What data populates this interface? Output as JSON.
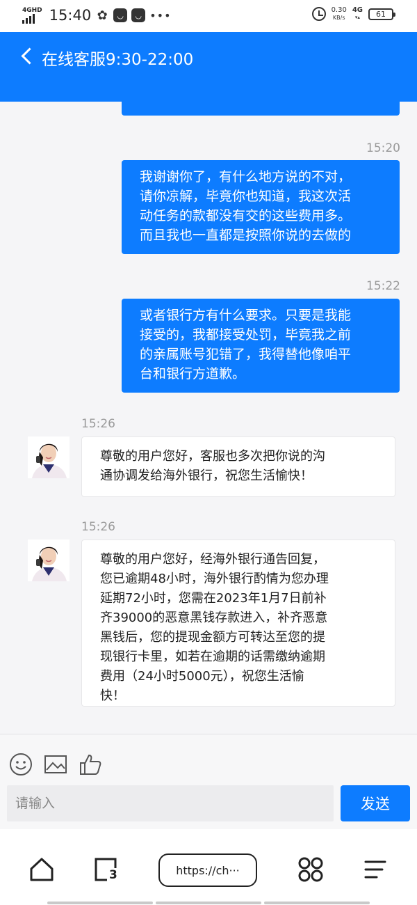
{
  "status_bar": {
    "network_type": "4GHD",
    "time": "15:40",
    "speed_value": "0.30",
    "speed_unit": "KB/s",
    "cellular": "4G",
    "battery": "61"
  },
  "header": {
    "title": "在线客服9:30-22:00"
  },
  "messages": [
    {
      "side": "right",
      "time": "15:20",
      "lines": [
        "我谢谢你了，有什么地方说的不对，",
        "请你凉解，毕竟你也知道，我这次活",
        "动任务的款都没有交的这些费用多。",
        "而且我也一直都是按照你说的去做的"
      ]
    },
    {
      "side": "right",
      "time": "15:22",
      "lines": [
        "或者银行方有什么要求。只要是我能",
        "接受的，我都接受处罚，毕竟我之前",
        "的亲属账号犯错了，我得替他像咱平",
        "台和银行方道歉。"
      ]
    },
    {
      "side": "left",
      "time": "15:26",
      "lines": [
        "尊敬的用户您好，客服也多次把你说的沟",
        "通协调发给海外银行，祝您生活愉快！"
      ]
    },
    {
      "side": "left",
      "time": "15:26",
      "lines": [
        "尊敬的用户您好，经海外银行通告回复，",
        "您已逾期48小时，海外银行酌情为您办理",
        "延期72小时，您需在2023年1月7日前补",
        "齐39000的恶意黑钱存款进入，补齐恶意",
        "黑钱后，您的提现金额方可转达至您的提",
        "现银行卡里，如若在逾期的话需缴纳逾期",
        "费用（24小时5000元），祝您生活愉",
        "快！"
      ]
    }
  ],
  "composer": {
    "placeholder": "请输入",
    "send_label": "发送",
    "tools": [
      "emoji-icon",
      "image-icon",
      "thumbs-up-icon"
    ]
  },
  "browser_nav": {
    "url": "https://ch···",
    "tab_count": "3",
    "buttons": [
      "home-icon",
      "tabs-icon",
      "apps-icon",
      "menu-icon"
    ]
  },
  "colors": {
    "accent": "#0d7cff",
    "chat_bg": "#f5f5f7",
    "incoming_bubble": "#ffffff"
  }
}
